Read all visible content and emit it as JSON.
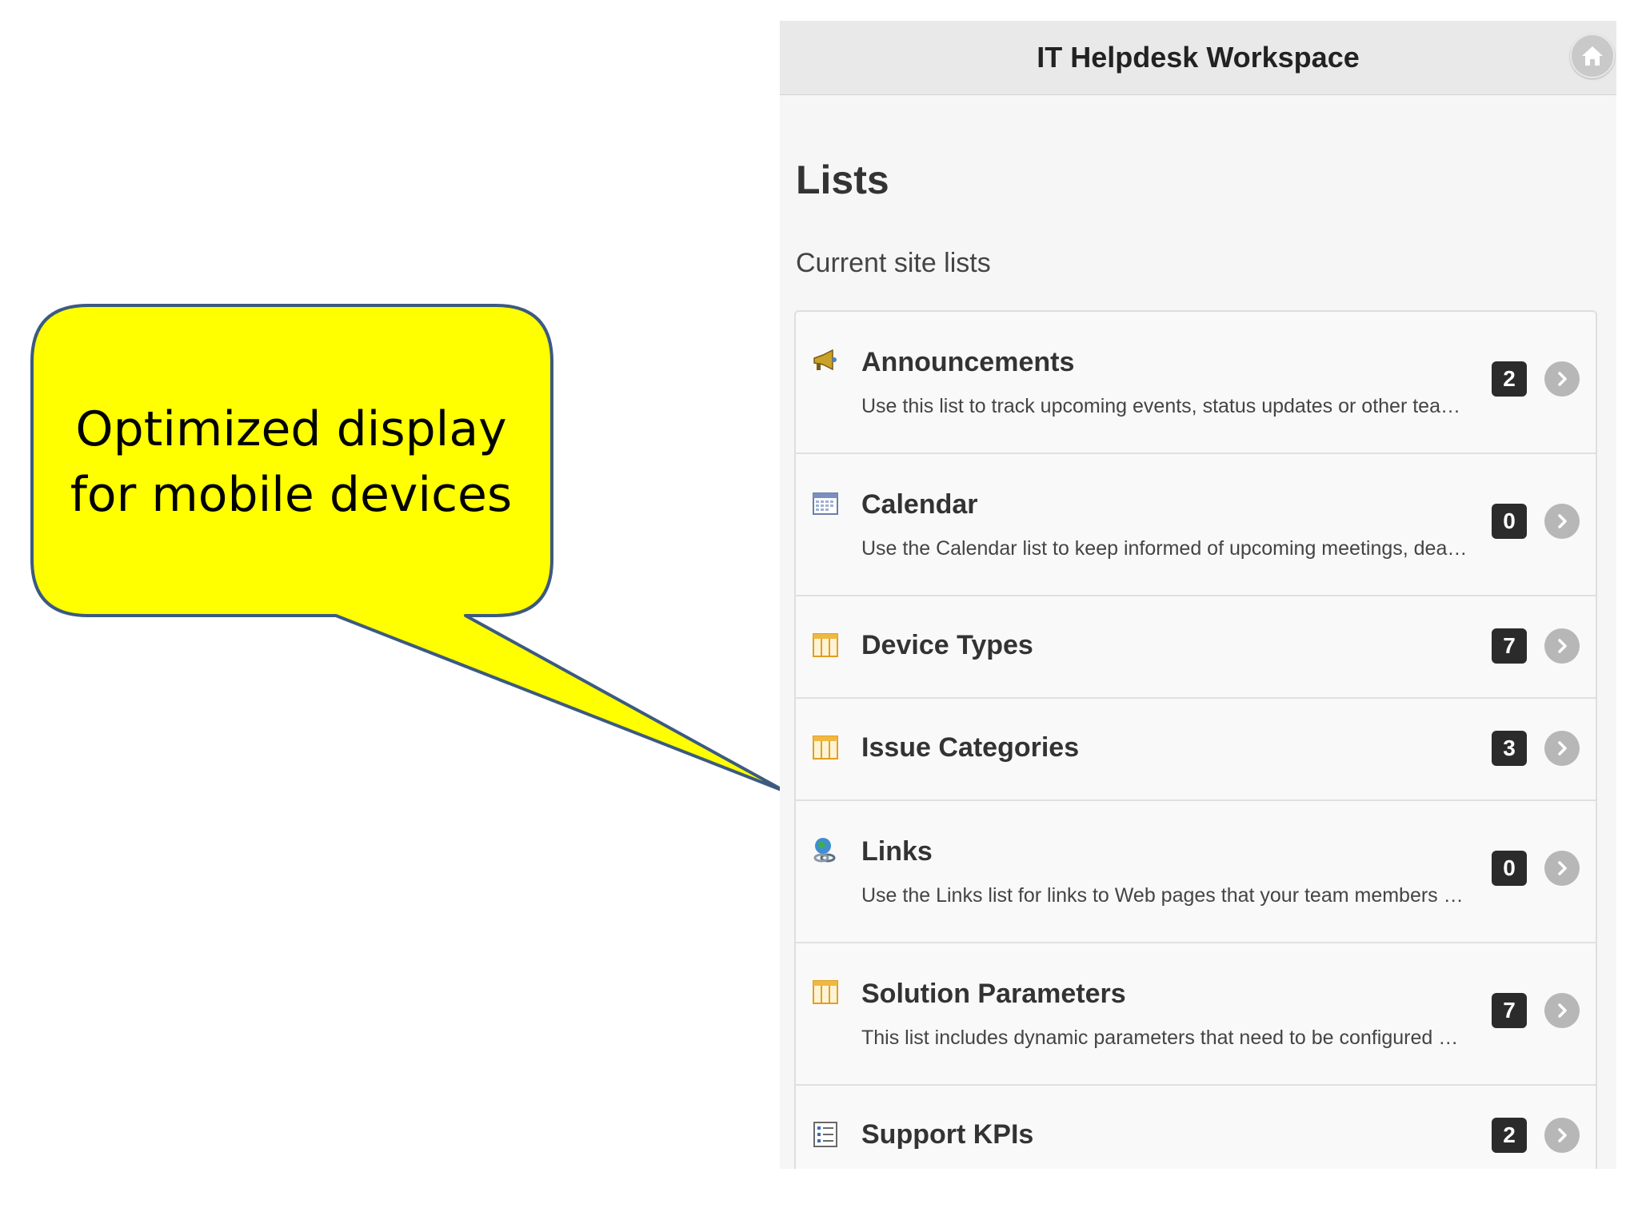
{
  "callout": {
    "line1": "Optimized display",
    "line2": "for mobile devices",
    "fill_color": "#ffff00",
    "border_color": "#3c5a80"
  },
  "header": {
    "title": "IT Helpdesk Workspace",
    "home_icon": "home-icon"
  },
  "page": {
    "title": "Lists",
    "subtitle": "Current site lists"
  },
  "lists": [
    {
      "title": "Announcements",
      "description": "Use this list to track upcoming events, status updates or other team...",
      "count": "2",
      "icon": "announcement-icon"
    },
    {
      "title": "Calendar",
      "description": "Use the Calendar list to keep informed of upcoming meetings, deadl...",
      "count": "0",
      "icon": "calendar-icon"
    },
    {
      "title": "Device Types",
      "description": "",
      "count": "7",
      "icon": "list-icon"
    },
    {
      "title": "Issue Categories",
      "description": "",
      "count": "3",
      "icon": "list-icon"
    },
    {
      "title": "Links",
      "description": "Use the Links list for links to Web pages that your team members wi...",
      "count": "0",
      "icon": "links-icon"
    },
    {
      "title": "Solution Parameters",
      "description": "This list includes dynamic parameters that need to be configured by...",
      "count": "7",
      "icon": "list-icon"
    },
    {
      "title": "Support KPIs",
      "description": "",
      "count": "2",
      "icon": "kpi-icon"
    }
  ]
}
